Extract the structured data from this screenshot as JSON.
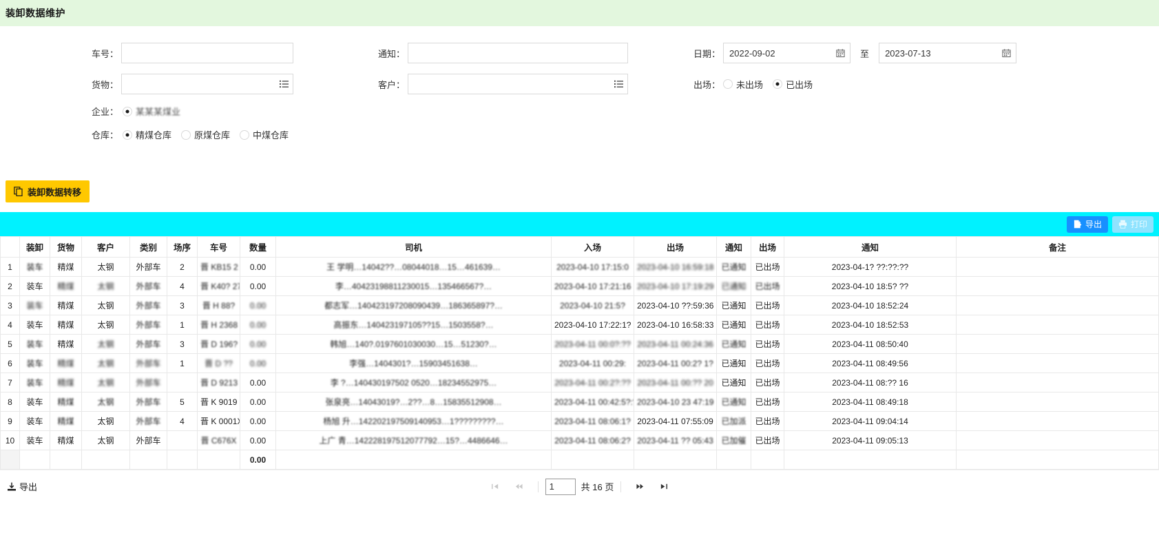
{
  "header": {
    "title": "装卸数据维护"
  },
  "form": {
    "car_no": {
      "label": "车号：",
      "value": "",
      "placeholder": ""
    },
    "notice": {
      "label": "通知：",
      "value": "",
      "placeholder": ""
    },
    "date": {
      "label": "日期：",
      "from": "2022-09-02",
      "to_label": "至",
      "to": "2023-07-13",
      "icon": "calendar-icon"
    },
    "goods": {
      "label": "货物：",
      "value": "",
      "placeholder": "",
      "icon": "list-select-icon"
    },
    "customer": {
      "label": "客户：",
      "value": "",
      "placeholder": "",
      "icon": "list-select-icon"
    },
    "exit": {
      "label": "出场：",
      "options": [
        "未出场",
        "已出场"
      ],
      "selected": "已出场"
    },
    "enterprise": {
      "label": "企业：",
      "options": [
        "某某某煤业"
      ],
      "selected": "某某某煤业",
      "obscured": true
    },
    "warehouse": {
      "label": "仓库：",
      "options": [
        "精煤仓库",
        "原煤仓库",
        "中煤仓库"
      ],
      "selected": "精煤仓库"
    }
  },
  "actions": {
    "transfer_label": "装卸数据转移",
    "transfer_icon": "copy-icon"
  },
  "toolbar": {
    "export_label": "导出",
    "export_icon": "file-export-icon",
    "print_label": "打印",
    "print_icon": "printer-icon",
    "print_disabled": true,
    "background": "#00f2ff"
  },
  "table": {
    "columns": [
      "",
      "装卸",
      "货物",
      "客户",
      "类别",
      "场序",
      "车号",
      "数量",
      "司机",
      "入场",
      "出场",
      "通知",
      "出场",
      "通知",
      "备注"
    ],
    "rows": [
      {
        "no": "1",
        "load": "装车",
        "goods": "精煤",
        "customer": "太钢",
        "type": "外部车",
        "seq": "2",
        "car": "晋 KB15 2",
        "qty": "0.00",
        "driver": "王 学明…14042??…08044018…15…461639…",
        "enter": "2023-04-10 17:15:0",
        "exit": "2023-04-10 16:59:18",
        "notify_time": "2023-04-1? ??:??:??",
        "notify": "已通知",
        "exit_status": "已出场",
        "remark": ""
      },
      {
        "no": "2",
        "load": "装车",
        "goods": "精煤",
        "customer": "太钢",
        "type": "外部车",
        "seq": "4",
        "car": "晋 K40? 27",
        "qty": "0.00",
        "driver": "李…40423198811230015…135466567?…",
        "enter": "2023-04-10 17:21:16",
        "exit": "2023-04-10 17:19:29",
        "notify_time": "2023-04-10 18:5? ??",
        "notify": "已通知",
        "exit_status": "已出场",
        "remark": ""
      },
      {
        "no": "3",
        "load": "装车",
        "goods": "精煤",
        "customer": "太钢",
        "type": "外部车",
        "seq": "3",
        "car": "晋 H 88?",
        "qty": "0.00",
        "driver": "都志军…140423197208090439…186365897?…",
        "enter": "2023-04-10 21:5?",
        "exit": "2023-04-10 ??:59:36",
        "notify_time": "2023-04-10 18:52:24",
        "notify": "已通知",
        "exit_status": "已出场",
        "remark": ""
      },
      {
        "no": "4",
        "load": "装车",
        "goods": "精煤",
        "customer": "太钢",
        "type": "外部车",
        "seq": "1",
        "car": "晋 H 2368",
        "qty": "0.00",
        "driver": "高振东…140423197105??15…1503558?…",
        "enter": "2023-04-10 17:22:1?",
        "exit": "2023-04-10 16:58:33",
        "notify_time": "2023-04-10 18:52:53",
        "notify": "已通知",
        "exit_status": "已出场",
        "remark": ""
      },
      {
        "no": "5",
        "load": "装车",
        "goods": "精煤",
        "customer": "太钢",
        "type": "外部车",
        "seq": "3",
        "car": "晋 D 196?",
        "qty": "0.00",
        "driver": "韩旭…140?.0197601030030…15…51230?…",
        "enter": "2023-04-11 00:0?:??",
        "exit": "2023-04-11 00:24:36",
        "notify_time": "2023-04-11 08:50:40",
        "notify": "已通知",
        "exit_status": "已出场",
        "remark": ""
      },
      {
        "no": "6",
        "load": "装车",
        "goods": "精煤",
        "customer": "太钢",
        "type": "外部车",
        "seq": "1",
        "car": "晋 D ??",
        "qty": "0.00",
        "driver": "李强…1404301?…15903451638…",
        "enter": "2023-04-11 00:29:",
        "exit": "2023-04-11 00:2? 1?",
        "notify_time": "2023-04-11 08:49:56",
        "notify": "已通知",
        "exit_status": "已出场",
        "remark": ""
      },
      {
        "no": "7",
        "load": "装车",
        "goods": "精煤",
        "customer": "太钢",
        "type": "外部车",
        "seq": "",
        "car": "晋 D 9213",
        "qty": "0.00",
        "driver": "李 ?…140430197502 0520…18234552975…",
        "enter": "2023-04-11 00:2?:??",
        "exit": "2023-04-11 00:?? 20",
        "notify_time": "2023-04-11 08:?? 16",
        "notify": "已通知",
        "exit_status": "已出场",
        "remark": ""
      },
      {
        "no": "8",
        "load": "装车",
        "goods": "精煤",
        "customer": "太钢",
        "type": "外部车",
        "seq": "5",
        "car": "晋 K 9019",
        "qty": "0.00",
        "driver": "张泉亮…14043019?…2??…8…15835512908…",
        "enter": "2023-04-11 00:42:5?:?",
        "exit": "2023-04-10 23 47:19",
        "notify_time": "2023-04-11 08:49:18",
        "notify": "已通知",
        "exit_status": "已出场",
        "remark": ""
      },
      {
        "no": "9",
        "load": "装车",
        "goods": "精煤",
        "customer": "太钢",
        "type": "外部车",
        "seq": "4",
        "car": "晋 K 0001X",
        "qty": "0.00",
        "driver": "杨旭 升…142202197509140953…1?????????…",
        "enter": "2023-04-11 08:06:1?",
        "exit": "2023-04-11 07:55:09",
        "notify_time": "2023-04-11 09:04:14",
        "notify": "已加派",
        "exit_status": "已出场",
        "remark": ""
      },
      {
        "no": "10",
        "load": "装车",
        "goods": "精煤",
        "customer": "太钢",
        "type": "外部车",
        "seq": "",
        "car": "晋 C676X",
        "qty": "0.00",
        "driver": "上广 青…142228197512077792…15?…4486646…",
        "enter": "2023-04-11 08:06:2?",
        "exit": "2023-04-11 ?? 05:43",
        "notify_time": "2023-04-11 09:05:13",
        "notify": "已加催",
        "exit_status": "已出场",
        "remark": ""
      }
    ],
    "total_row": {
      "qty": "0.00"
    }
  },
  "footer": {
    "export_label": "导出",
    "export_icon": "download-icon",
    "pager": {
      "first_icon": "first-page-icon",
      "prev_icon": "prev-page-icon",
      "next_icon": "next-page-icon",
      "last_icon": "last-page-icon",
      "current_page": "1",
      "total_text": "共 16 页"
    }
  }
}
